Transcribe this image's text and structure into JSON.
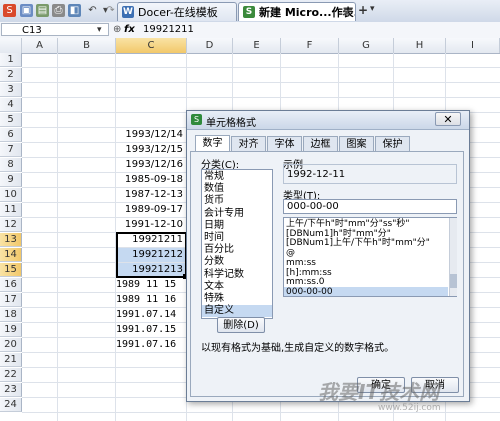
{
  "tabs": [
    {
      "label": "Docer-在线模板",
      "icon": "W"
    },
    {
      "label": "新建 Micro...作表.xls *",
      "icon": "S"
    }
  ],
  "formula_bar": {
    "cell_ref": "C13",
    "fx": "fx",
    "value": "19921211"
  },
  "columns": [
    "A",
    "B",
    "C",
    "D",
    "E",
    "F",
    "G",
    "H",
    "I"
  ],
  "rows": [
    "1",
    "2",
    "3",
    "4",
    "5",
    "6",
    "7",
    "8",
    "9",
    "10",
    "11",
    "12",
    "13",
    "14",
    "15",
    "16",
    "17",
    "18",
    "19",
    "20",
    "21",
    "22",
    "23",
    "24"
  ],
  "cells": [
    {
      "row": 6,
      "text": "1993/12/14",
      "mono": false
    },
    {
      "row": 7,
      "text": "1993/12/15",
      "mono": false
    },
    {
      "row": 8,
      "text": "1993/12/16",
      "mono": false
    },
    {
      "row": 9,
      "text": "1985-09-18",
      "mono": false
    },
    {
      "row": 10,
      "text": "1987-12-13",
      "mono": false
    },
    {
      "row": 11,
      "text": "1989-09-17",
      "mono": false
    },
    {
      "row": 12,
      "text": "1991-12-10",
      "mono": false
    },
    {
      "row": 13,
      "text": "19921211",
      "mono": false
    },
    {
      "row": 14,
      "text": "19921212",
      "mono": false
    },
    {
      "row": 15,
      "text": "19921213",
      "mono": false
    },
    {
      "row": 16,
      "text": "1989 11 15",
      "mono": true
    },
    {
      "row": 17,
      "text": "1989 11 16",
      "mono": true
    },
    {
      "row": 18,
      "text": "1991.07.14",
      "mono": true
    },
    {
      "row": 19,
      "text": "1991.07.15",
      "mono": true
    },
    {
      "row": 20,
      "text": "1991.07.16",
      "mono": true
    }
  ],
  "dialog": {
    "title": "单元格格式",
    "tabs": [
      "数字",
      "对齐",
      "字体",
      "边框",
      "图案",
      "保护"
    ],
    "category_label": "分类(C):",
    "categories": [
      "常规",
      "数值",
      "货币",
      "会计专用",
      "日期",
      "时间",
      "百分比",
      "分数",
      "科学记数",
      "文本",
      "特殊",
      "自定义"
    ],
    "selected_category": "自定义",
    "sample_label": "示例",
    "sample_value": "1992-12-11",
    "type_label": "类型(T):",
    "type_value": "000-00-00",
    "type_list": [
      "上午/下午h\"时\"mm\"分\"ss\"秒\"",
      "[DBNum1]h\"时\"mm\"分\"",
      "[DBNum1]上午/下午h\"时\"mm\"分\"",
      "@",
      "mm:ss",
      "[h]:mm:ss",
      "mm:ss.0",
      "000-00-00"
    ],
    "delete_button": "删除(D)",
    "hint": "以现有格式为基础,生成自定义的数字格式。",
    "ok_button": "确定",
    "cancel_button": "取消"
  },
  "watermark": {
    "text": "我要IT技术网",
    "url": "www.52ij.com"
  },
  "colors": {
    "accent": "#4a7cc7",
    "selection": "#c5d9f1",
    "header_selected": "#f2c86a"
  }
}
